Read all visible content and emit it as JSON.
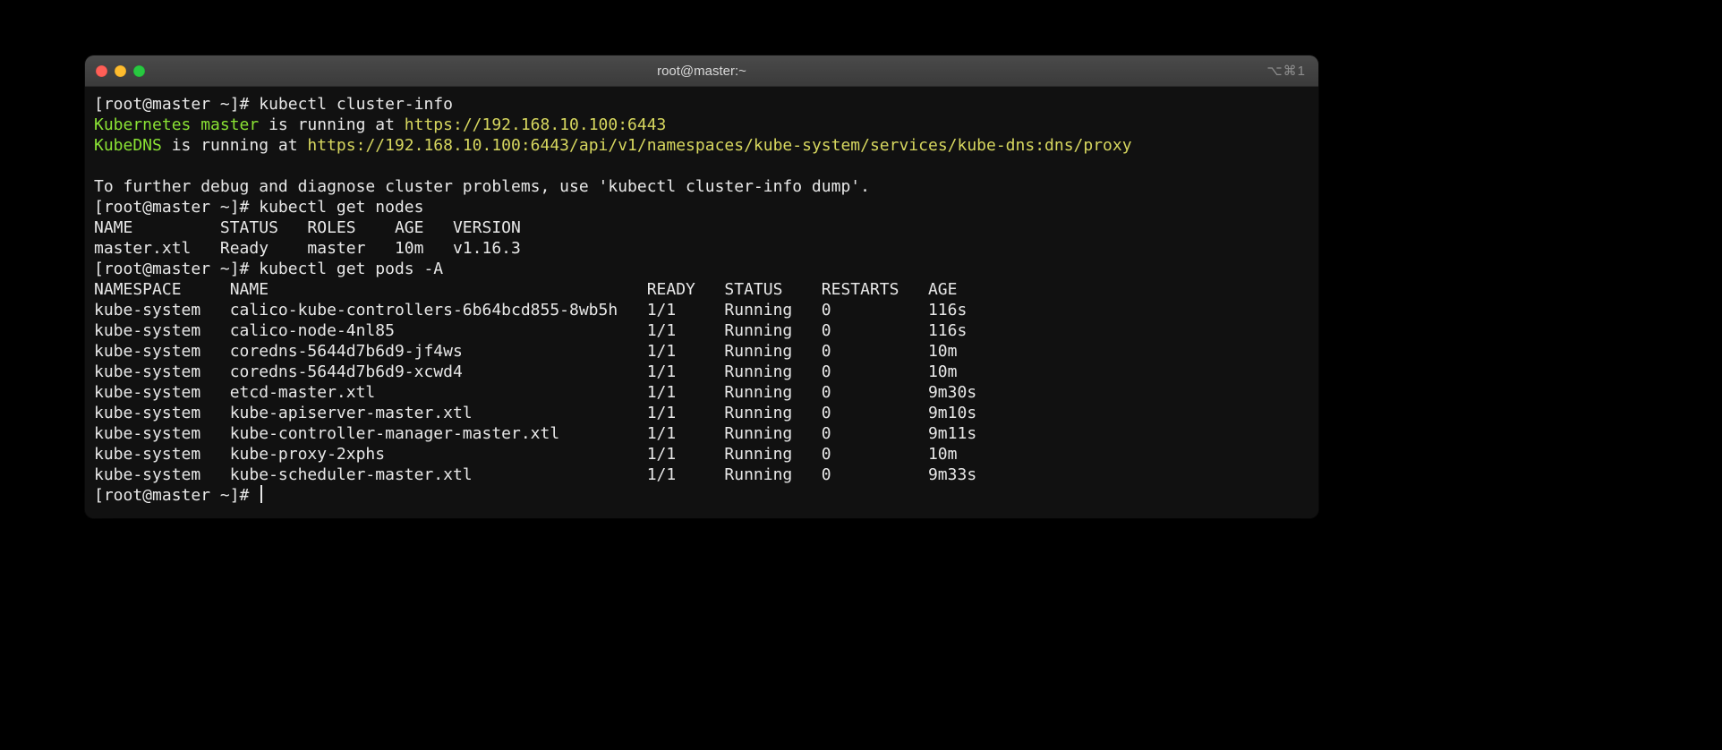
{
  "window": {
    "title": "root@master:~",
    "shortcut_hint": "⌥⌘1"
  },
  "prompt": "[root@master ~]# ",
  "cmd1": "kubectl cluster-info",
  "cluster_info": {
    "l1a": "Kubernetes master",
    "l1b": " is running at ",
    "l1c": "https://192.168.10.100:6443",
    "l2a": "KubeDNS",
    "l2b": " is running at ",
    "l2c": "https://192.168.10.100:6443/api/v1/namespaces/kube-system/services/kube-dns:dns/proxy"
  },
  "debug_hint": "To further debug and diagnose cluster problems, use 'kubectl cluster-info dump'.",
  "cmd2": "kubectl get nodes",
  "nodes_header": "NAME         STATUS   ROLES    AGE   VERSION",
  "nodes_row": "master.xtl   Ready    master   10m   v1.16.3",
  "cmd3": "kubectl get pods -A",
  "pods_header": "NAMESPACE     NAME                                       READY   STATUS    RESTARTS   AGE",
  "pods": [
    "kube-system   calico-kube-controllers-6b64bcd855-8wb5h   1/1     Running   0          116s",
    "kube-system   calico-node-4nl85                          1/1     Running   0          116s",
    "kube-system   coredns-5644d7b6d9-jf4ws                   1/1     Running   0          10m",
    "kube-system   coredns-5644d7b6d9-xcwd4                   1/1     Running   0          10m",
    "kube-system   etcd-master.xtl                            1/1     Running   0          9m30s",
    "kube-system   kube-apiserver-master.xtl                  1/1     Running   0          9m10s",
    "kube-system   kube-controller-manager-master.xtl         1/1     Running   0          9m11s",
    "kube-system   kube-proxy-2xphs                           1/1     Running   0          10m",
    "kube-system   kube-scheduler-master.xtl                  1/1     Running   0          9m33s"
  ]
}
